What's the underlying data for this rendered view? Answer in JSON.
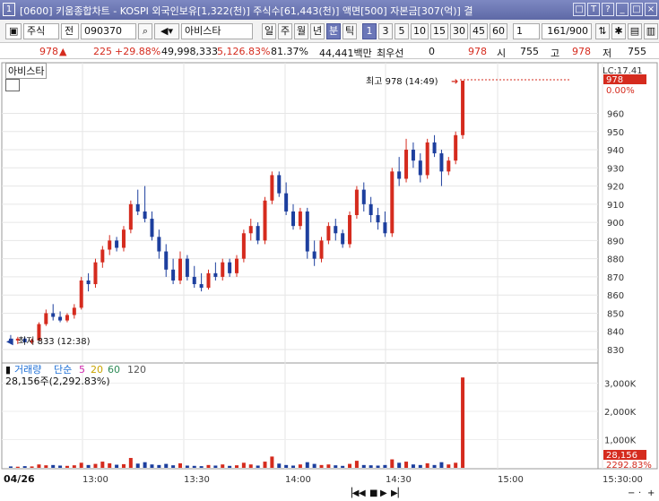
{
  "window": {
    "number": "1",
    "title": "[0600] 키움종합차트 - KOSPI 외국인보유[1,322(천)] 주식수[61,443(천)] 액면[500] 자본금[307(억)] 결"
  },
  "toolbar": {
    "market": "주식",
    "side": "전",
    "code": "090370",
    "stock_name": "아비스타",
    "periods": [
      "일",
      "주",
      "월",
      "년",
      "분",
      "틱"
    ],
    "intervals": [
      "1",
      "3",
      "5",
      "10",
      "15",
      "30",
      "45",
      "60"
    ],
    "active_interval": "1",
    "count": "1",
    "range": "161/900"
  },
  "info": {
    "price": "978",
    "change": "225",
    "change_pct": "+29.88%",
    "volume": "49,998,333",
    "vol_pct": "5,126.83%",
    "ratio": "81.37%",
    "amount": "44,441백만",
    "preferred": "최우선",
    "zero": "0",
    "last": "978",
    "open_label": "시",
    "open": "755",
    "high_label": "고",
    "high": "978",
    "low_label": "저",
    "low": "755"
  },
  "panel": {
    "name": "아비스타",
    "high_note": "최고 978 (14:49)",
    "low_note": "최저 833 (12:38)",
    "last_tag_top": "LC:17.41",
    "last_tag": "978",
    "last_tag_pct": "0.00%",
    "vol_title": "거래량",
    "vol_simple": "단순",
    "ma5": "5",
    "ma20": "20",
    "ma60": "60",
    "ma120": "120",
    "vol_value": "28,156주(2,292.83%)",
    "vol_tag": "28,156",
    "vol_tag_pct": "2292.83%",
    "date": "04/26"
  },
  "colors": {
    "up": "#d52b1e",
    "down": "#1d3f9e",
    "ma5": "#d42ab0",
    "ma20": "#c9a400",
    "ma60": "#2e8b57",
    "title_bg": "#6b77b8"
  },
  "chart_data": {
    "type": "candlestick",
    "price_axis": {
      "min": 830,
      "max": 978,
      "ticks": [
        830,
        840,
        850,
        860,
        870,
        880,
        890,
        900,
        910,
        920,
        930,
        940,
        950,
        960
      ]
    },
    "volume_axis": {
      "ticks": [
        "1,000K",
        "2,000K",
        "3,000K"
      ]
    },
    "time_ticks": [
      "13:00",
      "13:30",
      "14:00",
      "14:30",
      "15:00",
      "15:30:00"
    ],
    "candles": [
      [
        836,
        838,
        834,
        835
      ],
      [
        835,
        837,
        833,
        836
      ],
      [
        836,
        837,
        834,
        834
      ],
      [
        834,
        836,
        833,
        835
      ],
      [
        835,
        845,
        835,
        844
      ],
      [
        844,
        852,
        843,
        850
      ],
      [
        850,
        855,
        846,
        848
      ],
      [
        848,
        851,
        845,
        846
      ],
      [
        846,
        850,
        845,
        849
      ],
      [
        849,
        855,
        847,
        853
      ],
      [
        853,
        870,
        852,
        868
      ],
      [
        868,
        872,
        862,
        866
      ],
      [
        866,
        880,
        864,
        878
      ],
      [
        878,
        887,
        875,
        885
      ],
      [
        885,
        893,
        882,
        890
      ],
      [
        890,
        892,
        884,
        886
      ],
      [
        886,
        898,
        884,
        896
      ],
      [
        896,
        912,
        894,
        910
      ],
      [
        910,
        918,
        904,
        906
      ],
      [
        906,
        920,
        900,
        902
      ],
      [
        902,
        906,
        890,
        892
      ],
      [
        892,
        896,
        880,
        884
      ],
      [
        884,
        888,
        870,
        874
      ],
      [
        874,
        880,
        866,
        868
      ],
      [
        868,
        884,
        866,
        880
      ],
      [
        880,
        882,
        868,
        870
      ],
      [
        870,
        876,
        864,
        866
      ],
      [
        866,
        872,
        862,
        864
      ],
      [
        864,
        874,
        863,
        872
      ],
      [
        872,
        878,
        868,
        870
      ],
      [
        870,
        880,
        868,
        878
      ],
      [
        878,
        880,
        870,
        872
      ],
      [
        872,
        882,
        870,
        880
      ],
      [
        880,
        896,
        878,
        894
      ],
      [
        894,
        902,
        890,
        898
      ],
      [
        898,
        900,
        888,
        890
      ],
      [
        890,
        914,
        888,
        912
      ],
      [
        912,
        928,
        910,
        926
      ],
      [
        926,
        928,
        914,
        916
      ],
      [
        916,
        922,
        904,
        906
      ],
      [
        906,
        910,
        896,
        898
      ],
      [
        898,
        908,
        896,
        906
      ],
      [
        906,
        908,
        880,
        884
      ],
      [
        884,
        890,
        876,
        880
      ],
      [
        880,
        892,
        878,
        890
      ],
      [
        890,
        900,
        888,
        898
      ],
      [
        898,
        902,
        890,
        894
      ],
      [
        894,
        896,
        886,
        888
      ],
      [
        888,
        906,
        886,
        904
      ],
      [
        904,
        920,
        902,
        918
      ],
      [
        918,
        922,
        906,
        910
      ],
      [
        910,
        914,
        900,
        904
      ],
      [
        904,
        908,
        896,
        900
      ],
      [
        900,
        906,
        892,
        894
      ],
      [
        894,
        930,
        892,
        928
      ],
      [
        928,
        936,
        920,
        924
      ],
      [
        924,
        946,
        922,
        940
      ],
      [
        940,
        944,
        930,
        934
      ],
      [
        934,
        938,
        922,
        926
      ],
      [
        926,
        946,
        924,
        944
      ],
      [
        944,
        948,
        936,
        938
      ],
      [
        938,
        940,
        920,
        928
      ],
      [
        928,
        936,
        926,
        934
      ],
      [
        934,
        950,
        932,
        948
      ],
      [
        948,
        978,
        946,
        978
      ]
    ],
    "volumes": [
      0.05,
      0.04,
      0.06,
      0.05,
      0.12,
      0.09,
      0.1,
      0.08,
      0.07,
      0.09,
      0.18,
      0.1,
      0.14,
      0.22,
      0.16,
      0.11,
      0.13,
      0.35,
      0.15,
      0.2,
      0.12,
      0.1,
      0.14,
      0.09,
      0.16,
      0.08,
      0.07,
      0.06,
      0.1,
      0.08,
      0.12,
      0.07,
      0.09,
      0.18,
      0.12,
      0.08,
      0.22,
      0.4,
      0.15,
      0.1,
      0.08,
      0.12,
      0.2,
      0.14,
      0.1,
      0.12,
      0.09,
      0.07,
      0.14,
      0.25,
      0.1,
      0.09,
      0.08,
      0.1,
      0.3,
      0.18,
      0.22,
      0.12,
      0.1,
      0.16,
      0.1,
      0.2,
      0.12,
      0.18,
      3.2
    ]
  }
}
